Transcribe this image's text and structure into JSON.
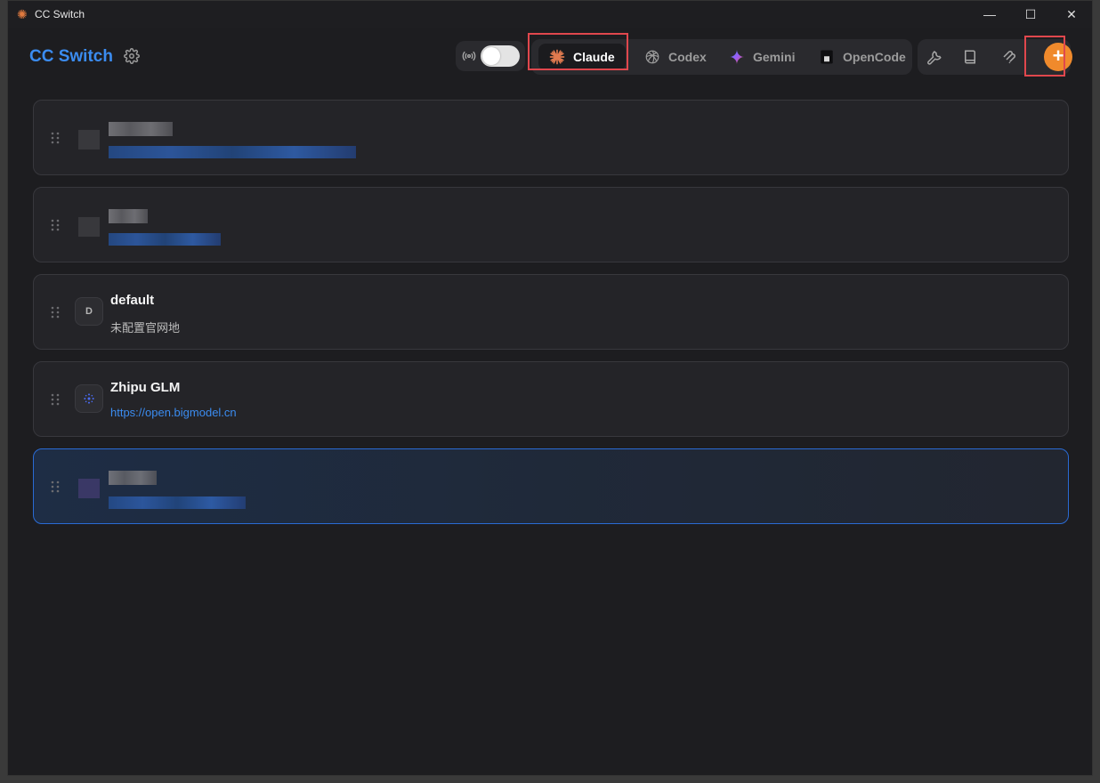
{
  "window": {
    "title": "CC Switch",
    "controls": {
      "minimize": "—",
      "maximize": "☐",
      "close": "✕"
    }
  },
  "header": {
    "brand": "CC Switch",
    "proxy_toggle_on": false,
    "apps": [
      {
        "label": "Claude",
        "icon": "claude-icon",
        "active": true
      },
      {
        "label": "Codex",
        "icon": "codex-icon",
        "active": false
      },
      {
        "label": "Gemini",
        "icon": "gemini-icon",
        "active": false
      },
      {
        "label": "OpenCode",
        "icon": "opencode-icon",
        "active": false
      }
    ],
    "tools": [
      "wrench-icon",
      "book-icon",
      "mcp-icon"
    ],
    "add_label": "+"
  },
  "providers": [
    {
      "name": "",
      "url": "",
      "avatar": "",
      "blurred": true
    },
    {
      "name": "",
      "url": "",
      "avatar": "",
      "blurred": true
    },
    {
      "name": "default",
      "url": "未配置官网地",
      "avatar": "D",
      "blurred": false
    },
    {
      "name": "Zhipu GLM",
      "url": "https://open.bigmodel.cn",
      "avatar": "",
      "blurred": false
    },
    {
      "name": "",
      "url": "",
      "avatar": "",
      "blurred": true,
      "active": true
    }
  ],
  "colors": {
    "accent": "#3b8cf0",
    "add_button": "#f08a2c",
    "highlight": "#e0474d",
    "background": "#1d1d20"
  }
}
